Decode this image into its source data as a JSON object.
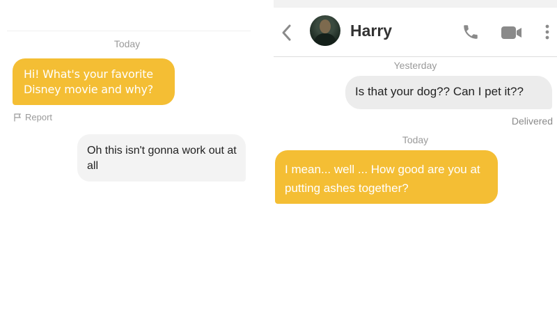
{
  "left": {
    "date_label": "Today",
    "messages": [
      {
        "text": "Hi! What's your favorite Disney movie and why?"
      },
      {
        "text": "Oh this isn't gonna work out at all"
      }
    ],
    "report_label": "Report"
  },
  "right": {
    "contact_name": "Harry",
    "date_yesterday": "Yesterday",
    "date_today": "Today",
    "messages": [
      {
        "text": "Is that your dog?? Can I pet it??"
      },
      {
        "text": "I mean... well ... How good are you at putting ashes together?"
      }
    ],
    "status": "Delivered",
    "icons": [
      "back-chevron-icon",
      "phone-icon",
      "video-camera-icon",
      "more-options-icon"
    ]
  },
  "colors": {
    "accent_yellow": "#f4be34",
    "incoming_grey": "#f3f3f3",
    "outgoing_grey": "#ececec",
    "meta_text": "#9a9a9a"
  }
}
